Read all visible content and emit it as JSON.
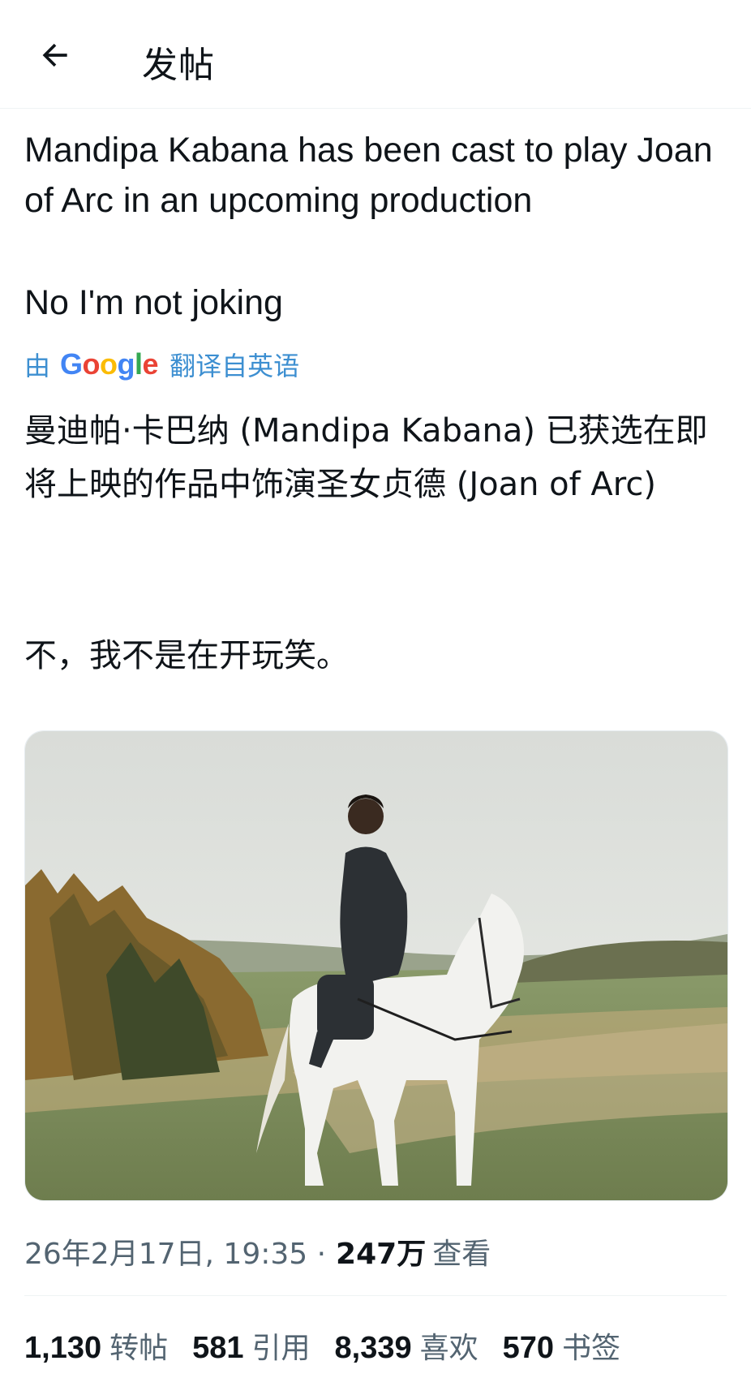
{
  "header": {
    "title": "发帖"
  },
  "post": {
    "original_line1": "Mandipa Kabana has been cast to play Joan of Arc in an upcoming production",
    "original_line2": "No I'm not joking",
    "translation": {
      "by": "由",
      "provider": "Google",
      "label": "翻译自英语",
      "text1": "曼迪帕·卡巴纳 (Mandipa Kabana) 已获选在即将上映的作品中饰演圣女贞德 (Joan of Arc)",
      "text2": "不，我不是在开玩笑。"
    },
    "timestamp": "26年2月17日, 19:35 ·",
    "views_count": "247万",
    "views_label": "查看"
  },
  "stats": [
    {
      "count": "1,130",
      "label": "转帖"
    },
    {
      "count": "581",
      "label": "引用"
    },
    {
      "count": "8,339",
      "label": "喜欢"
    },
    {
      "count": "570",
      "label": "书签"
    }
  ],
  "colors": {
    "link_blue": "#3d8fd1",
    "secondary_text": "#536471",
    "primary_text": "#0f1419"
  },
  "icons": {
    "back": "arrow-left-icon"
  }
}
